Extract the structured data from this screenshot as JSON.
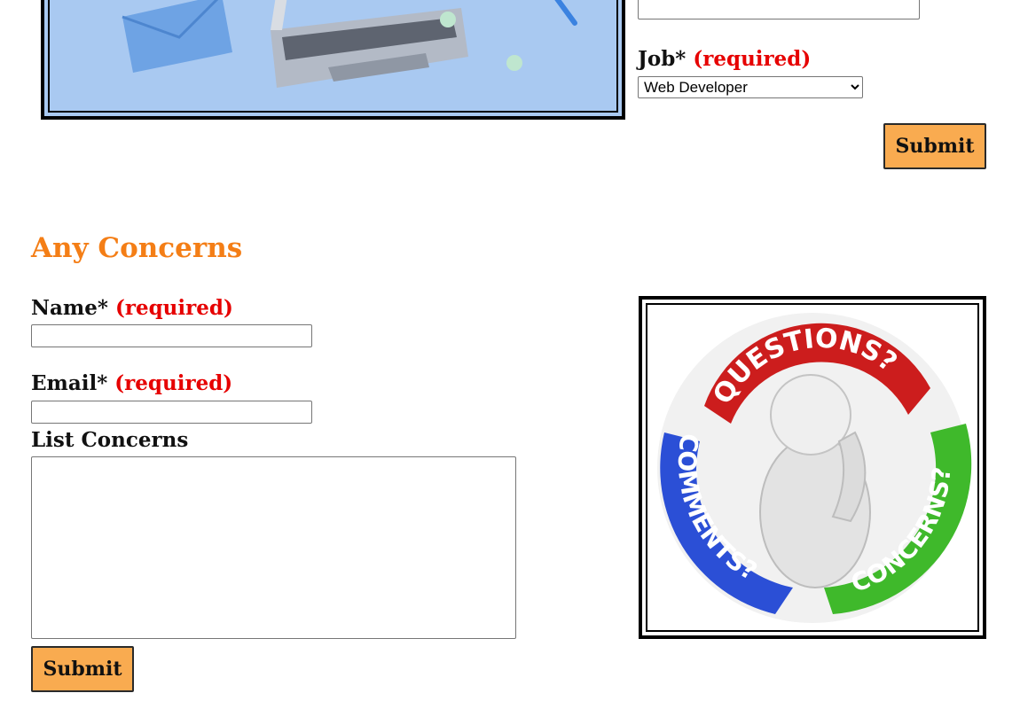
{
  "application_form": {
    "job_label": "Job*",
    "job_required": "(required)",
    "job_selected": "Web Developer",
    "job_options": [
      "Web Developer"
    ],
    "submit_label": "Submit"
  },
  "concerns_form": {
    "title": "Any Concerns",
    "name_label": "Name*",
    "name_required": "(required)",
    "email_label": "Email*",
    "email_required": "(required)",
    "list_label": "List Concerns",
    "submit_label": "Submit"
  },
  "concerns_image": {
    "questions": "QUESTIONS?",
    "comments": "COMMENTS?",
    "concerns": "CONCERNS?"
  },
  "colors": {
    "accent_orange": "#f47e16",
    "required_red": "#e60000",
    "button_bg": "#f9ab50"
  }
}
